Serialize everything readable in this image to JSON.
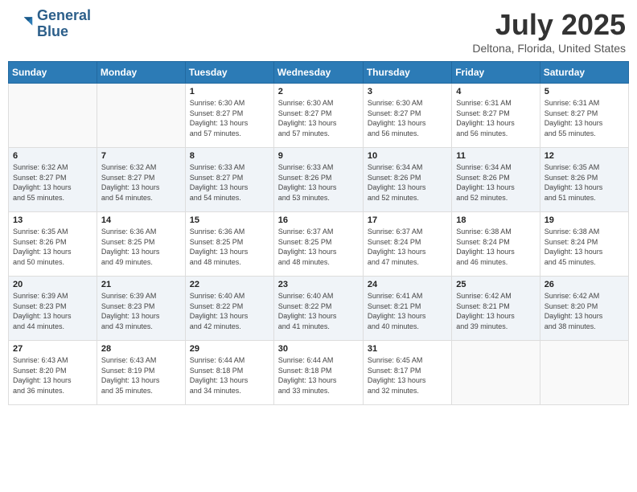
{
  "header": {
    "logo_line1": "General",
    "logo_line2": "Blue",
    "month": "July 2025",
    "location": "Deltona, Florida, United States"
  },
  "weekdays": [
    "Sunday",
    "Monday",
    "Tuesday",
    "Wednesday",
    "Thursday",
    "Friday",
    "Saturday"
  ],
  "weeks": [
    [
      {
        "day": "",
        "info": ""
      },
      {
        "day": "",
        "info": ""
      },
      {
        "day": "1",
        "info": "Sunrise: 6:30 AM\nSunset: 8:27 PM\nDaylight: 13 hours\nand 57 minutes."
      },
      {
        "day": "2",
        "info": "Sunrise: 6:30 AM\nSunset: 8:27 PM\nDaylight: 13 hours\nand 57 minutes."
      },
      {
        "day": "3",
        "info": "Sunrise: 6:30 AM\nSunset: 8:27 PM\nDaylight: 13 hours\nand 56 minutes."
      },
      {
        "day": "4",
        "info": "Sunrise: 6:31 AM\nSunset: 8:27 PM\nDaylight: 13 hours\nand 56 minutes."
      },
      {
        "day": "5",
        "info": "Sunrise: 6:31 AM\nSunset: 8:27 PM\nDaylight: 13 hours\nand 55 minutes."
      }
    ],
    [
      {
        "day": "6",
        "info": "Sunrise: 6:32 AM\nSunset: 8:27 PM\nDaylight: 13 hours\nand 55 minutes."
      },
      {
        "day": "7",
        "info": "Sunrise: 6:32 AM\nSunset: 8:27 PM\nDaylight: 13 hours\nand 54 minutes."
      },
      {
        "day": "8",
        "info": "Sunrise: 6:33 AM\nSunset: 8:27 PM\nDaylight: 13 hours\nand 54 minutes."
      },
      {
        "day": "9",
        "info": "Sunrise: 6:33 AM\nSunset: 8:26 PM\nDaylight: 13 hours\nand 53 minutes."
      },
      {
        "day": "10",
        "info": "Sunrise: 6:34 AM\nSunset: 8:26 PM\nDaylight: 13 hours\nand 52 minutes."
      },
      {
        "day": "11",
        "info": "Sunrise: 6:34 AM\nSunset: 8:26 PM\nDaylight: 13 hours\nand 52 minutes."
      },
      {
        "day": "12",
        "info": "Sunrise: 6:35 AM\nSunset: 8:26 PM\nDaylight: 13 hours\nand 51 minutes."
      }
    ],
    [
      {
        "day": "13",
        "info": "Sunrise: 6:35 AM\nSunset: 8:26 PM\nDaylight: 13 hours\nand 50 minutes."
      },
      {
        "day": "14",
        "info": "Sunrise: 6:36 AM\nSunset: 8:25 PM\nDaylight: 13 hours\nand 49 minutes."
      },
      {
        "day": "15",
        "info": "Sunrise: 6:36 AM\nSunset: 8:25 PM\nDaylight: 13 hours\nand 48 minutes."
      },
      {
        "day": "16",
        "info": "Sunrise: 6:37 AM\nSunset: 8:25 PM\nDaylight: 13 hours\nand 48 minutes."
      },
      {
        "day": "17",
        "info": "Sunrise: 6:37 AM\nSunset: 8:24 PM\nDaylight: 13 hours\nand 47 minutes."
      },
      {
        "day": "18",
        "info": "Sunrise: 6:38 AM\nSunset: 8:24 PM\nDaylight: 13 hours\nand 46 minutes."
      },
      {
        "day": "19",
        "info": "Sunrise: 6:38 AM\nSunset: 8:24 PM\nDaylight: 13 hours\nand 45 minutes."
      }
    ],
    [
      {
        "day": "20",
        "info": "Sunrise: 6:39 AM\nSunset: 8:23 PM\nDaylight: 13 hours\nand 44 minutes."
      },
      {
        "day": "21",
        "info": "Sunrise: 6:39 AM\nSunset: 8:23 PM\nDaylight: 13 hours\nand 43 minutes."
      },
      {
        "day": "22",
        "info": "Sunrise: 6:40 AM\nSunset: 8:22 PM\nDaylight: 13 hours\nand 42 minutes."
      },
      {
        "day": "23",
        "info": "Sunrise: 6:40 AM\nSunset: 8:22 PM\nDaylight: 13 hours\nand 41 minutes."
      },
      {
        "day": "24",
        "info": "Sunrise: 6:41 AM\nSunset: 8:21 PM\nDaylight: 13 hours\nand 40 minutes."
      },
      {
        "day": "25",
        "info": "Sunrise: 6:42 AM\nSunset: 8:21 PM\nDaylight: 13 hours\nand 39 minutes."
      },
      {
        "day": "26",
        "info": "Sunrise: 6:42 AM\nSunset: 8:20 PM\nDaylight: 13 hours\nand 38 minutes."
      }
    ],
    [
      {
        "day": "27",
        "info": "Sunrise: 6:43 AM\nSunset: 8:20 PM\nDaylight: 13 hours\nand 36 minutes."
      },
      {
        "day": "28",
        "info": "Sunrise: 6:43 AM\nSunset: 8:19 PM\nDaylight: 13 hours\nand 35 minutes."
      },
      {
        "day": "29",
        "info": "Sunrise: 6:44 AM\nSunset: 8:18 PM\nDaylight: 13 hours\nand 34 minutes."
      },
      {
        "day": "30",
        "info": "Sunrise: 6:44 AM\nSunset: 8:18 PM\nDaylight: 13 hours\nand 33 minutes."
      },
      {
        "day": "31",
        "info": "Sunrise: 6:45 AM\nSunset: 8:17 PM\nDaylight: 13 hours\nand 32 minutes."
      },
      {
        "day": "",
        "info": ""
      },
      {
        "day": "",
        "info": ""
      }
    ]
  ]
}
